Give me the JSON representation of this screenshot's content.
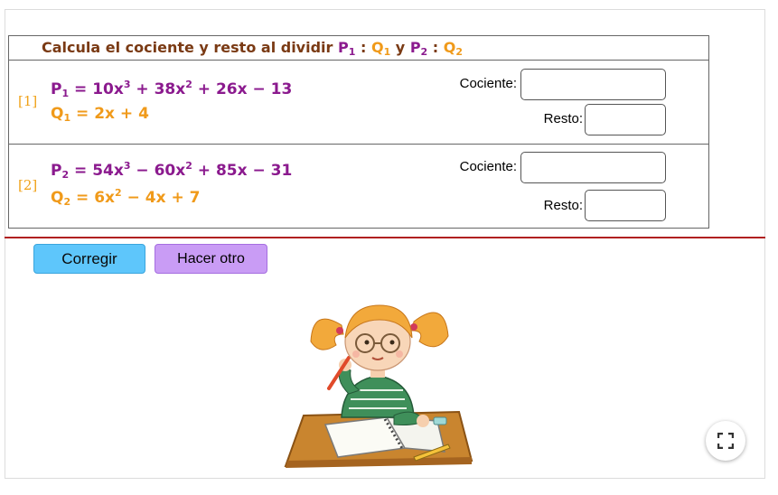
{
  "title": {
    "text": "Calcula el cociente y resto al dividir",
    "p1": "P",
    "p1_sub": "1",
    "colon1": ":",
    "q1": "Q",
    "q1_sub": "1",
    "y": "y",
    "p2": "P",
    "p2_sub": "2",
    "colon2": ":",
    "q2": "Q",
    "q2_sub": "2"
  },
  "exercises": [
    {
      "index": "[1]",
      "p_name": "P",
      "p_sub": "1",
      "p_parts": [
        "10x",
        "3",
        " + 38x",
        "2",
        " + 26x − 13"
      ],
      "q_name": "Q",
      "q_sub": "1",
      "q_parts": [
        "2x + 4"
      ],
      "cociente_label": "Cociente:",
      "cociente_value": "",
      "resto_label": "Resto:",
      "resto_value": ""
    },
    {
      "index": "[2]",
      "p_name": "P",
      "p_sub": "2",
      "p_parts": [
        "54x",
        "3",
        " − 60x",
        "2",
        " + 85x − 31"
      ],
      "q_name": "Q",
      "q_sub": "2",
      "q_parts": [
        "6x",
        "2",
        " − 4x + 7"
      ],
      "cociente_label": "Cociente:",
      "cociente_value": "",
      "resto_label": "Resto:",
      "resto_value": ""
    }
  ],
  "buttons": {
    "corregir": "Corregir",
    "hacer_otro": "Hacer otro"
  },
  "colors": {
    "title_brown": "#7a3a14",
    "p_purple": "#8b1a8e",
    "q_orange": "#f09a1a",
    "corregir_bg": "#5ec6fb",
    "hacer_otro_bg": "#c99cf5",
    "divider_red": "#b02020"
  },
  "icons": {
    "fullscreen": "fullscreen-icon",
    "illustration": "girl-thinking-at-desk"
  }
}
